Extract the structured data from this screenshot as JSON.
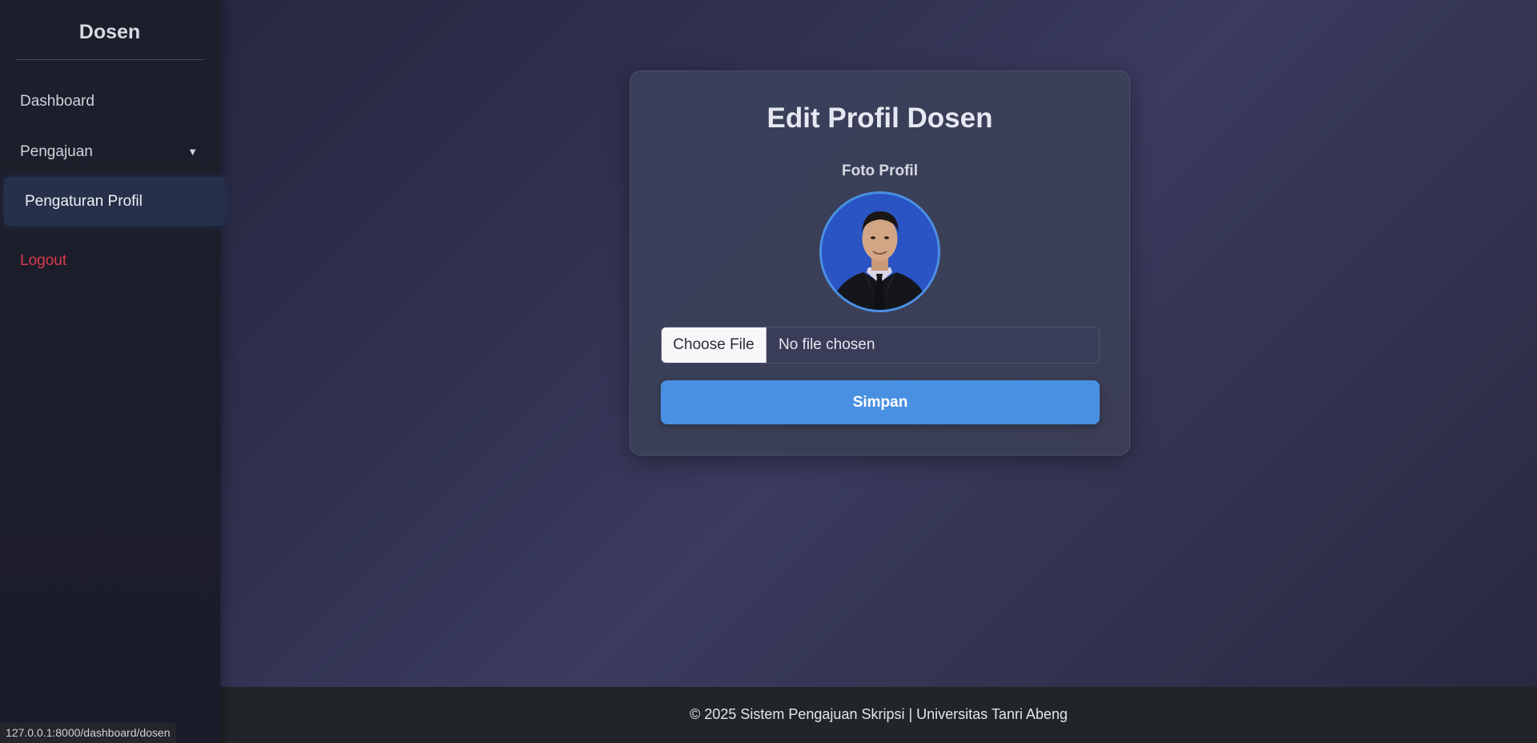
{
  "sidebar": {
    "title": "Dosen",
    "items": [
      {
        "label": "Dashboard"
      },
      {
        "label": "Pengajuan",
        "caret": "▼"
      },
      {
        "label": "Pengaturan Profil"
      },
      {
        "label": "Logout"
      }
    ]
  },
  "form": {
    "title": "Edit Profil Dosen",
    "photo_label": "Foto Profil",
    "file_button": "Choose File",
    "file_status": "No file chosen",
    "save_label": "Simpan"
  },
  "footer": {
    "text": "© 2025 Sistem Pengajuan Skripsi | Universitas Tanri Abeng"
  },
  "status_bar": {
    "url": "127.0.0.1:8000/dashboard/dosen"
  },
  "colors": {
    "accent": "#4a90e2",
    "logout": "#d93a4e",
    "avatar_background": "#2a54c4"
  },
  "icons": {
    "caret": "caret-down-icon"
  }
}
